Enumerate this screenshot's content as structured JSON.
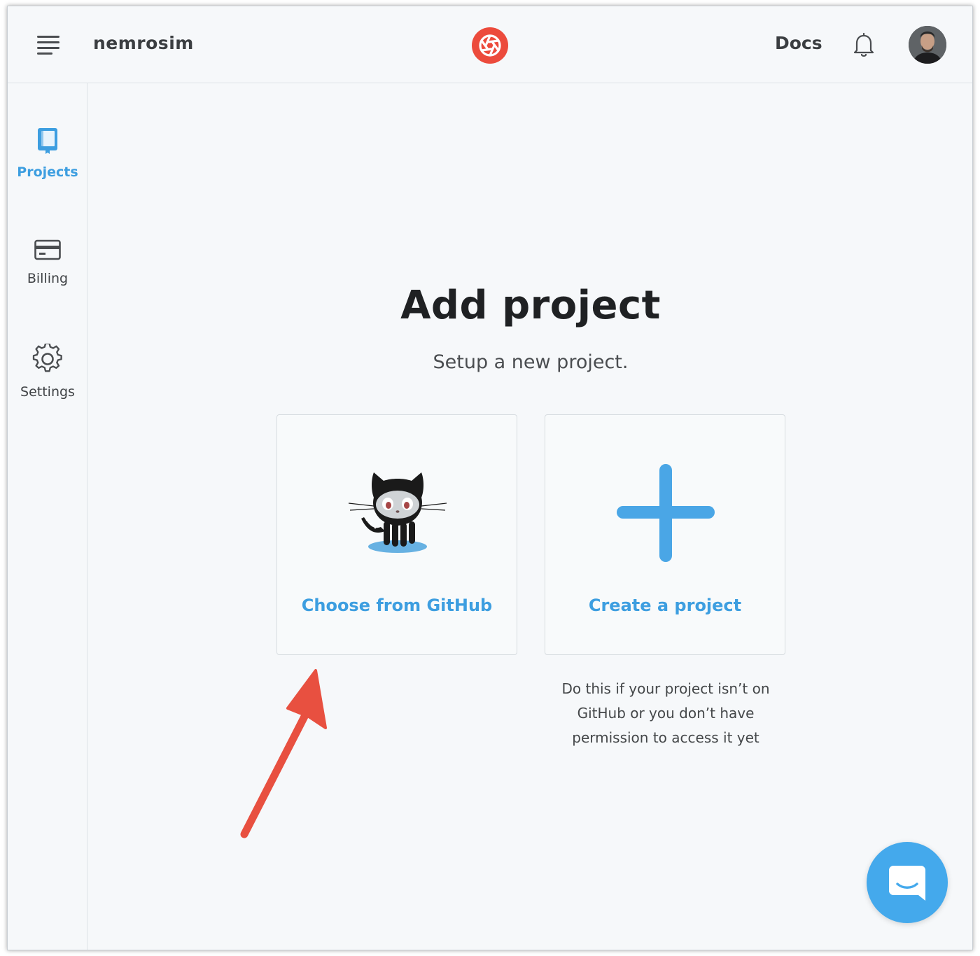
{
  "header": {
    "org_name": "nemrosim",
    "docs_label": "Docs",
    "menu_icon": "hamburger-menu-icon",
    "logo_icon": "app-logo-icon",
    "bell_icon": "bell-icon",
    "avatar": "user-avatar"
  },
  "sidebar": {
    "items": [
      {
        "label": "Projects",
        "icon": "book-icon",
        "active": true
      },
      {
        "label": "Billing",
        "icon": "credit-card-icon",
        "active": false
      },
      {
        "label": "Settings",
        "icon": "gear-icon",
        "active": false
      }
    ]
  },
  "main": {
    "title": "Add project",
    "subtitle": "Setup a new project.",
    "cards": [
      {
        "label": "Choose from GitHub",
        "icon": "github-octocat-icon"
      },
      {
        "label": "Create a project",
        "icon": "plus-icon"
      }
    ],
    "helper_lines": [
      "Do this if your project isn’t on",
      "GitHub or you don’t have",
      "permission to access it yet"
    ]
  },
  "chat": {
    "icon": "chat-bubble-icon"
  },
  "colors": {
    "accent": "#3d9ee0",
    "logo": "#ec4b3c",
    "arrow": "#e85040",
    "chat": "#44a9ec"
  }
}
